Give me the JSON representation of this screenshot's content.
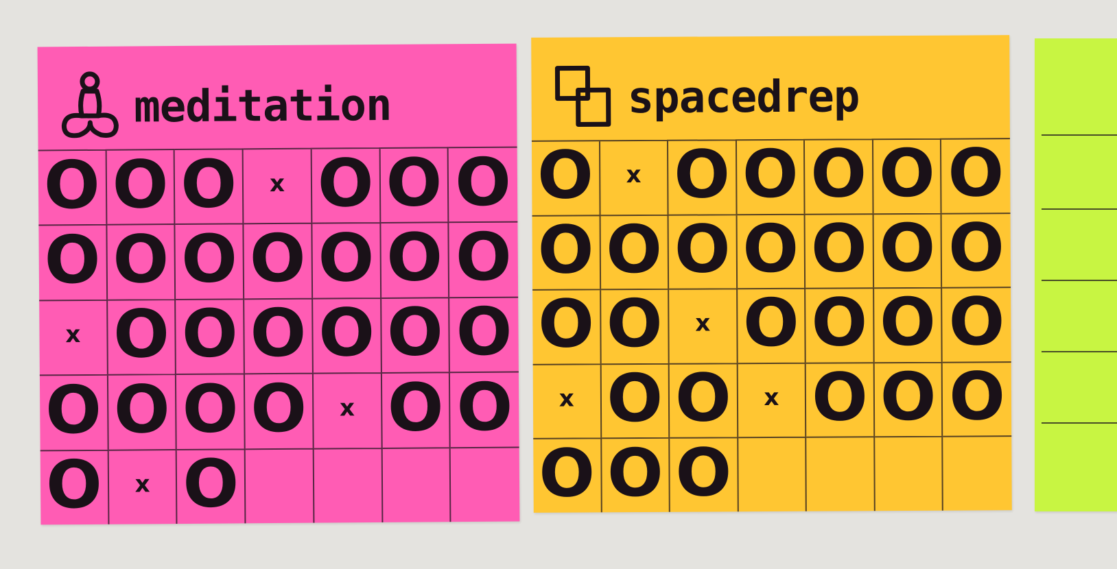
{
  "colors": {
    "wall": "#e4e3df",
    "ink": "#1a1118",
    "meditation": "#ff5cb4",
    "spacedrep": "#ffc632",
    "third": "#c8f542"
  },
  "notes": [
    {
      "id": "meditation",
      "title": "meditation",
      "icon": "meditation-icon",
      "rows": [
        [
          "O",
          "O",
          "O",
          "x",
          "O",
          "O",
          "O"
        ],
        [
          "O",
          "O",
          "O",
          "O",
          "O",
          "O",
          "O"
        ],
        [
          "x",
          "O",
          "O",
          "O",
          "O",
          "O",
          "O"
        ],
        [
          "O",
          "O",
          "O",
          "O",
          "x",
          "O",
          "O"
        ],
        [
          "O",
          "x",
          "O",
          "",
          "",
          "",
          ""
        ]
      ]
    },
    {
      "id": "spacedrep",
      "title": "spacedrep",
      "icon": "overlapping-squares-icon",
      "rows": [
        [
          "O",
          "x",
          "O",
          "O",
          "O",
          "O",
          "O"
        ],
        [
          "O",
          "O",
          "O",
          "O",
          "O",
          "O",
          "O"
        ],
        [
          "O",
          "O",
          "x",
          "O",
          "O",
          "O",
          "O"
        ],
        [
          "x",
          "O",
          "O",
          "x",
          "O",
          "O",
          "O"
        ],
        [
          "O",
          "O",
          "O",
          "",
          "",
          "",
          ""
        ]
      ]
    }
  ]
}
